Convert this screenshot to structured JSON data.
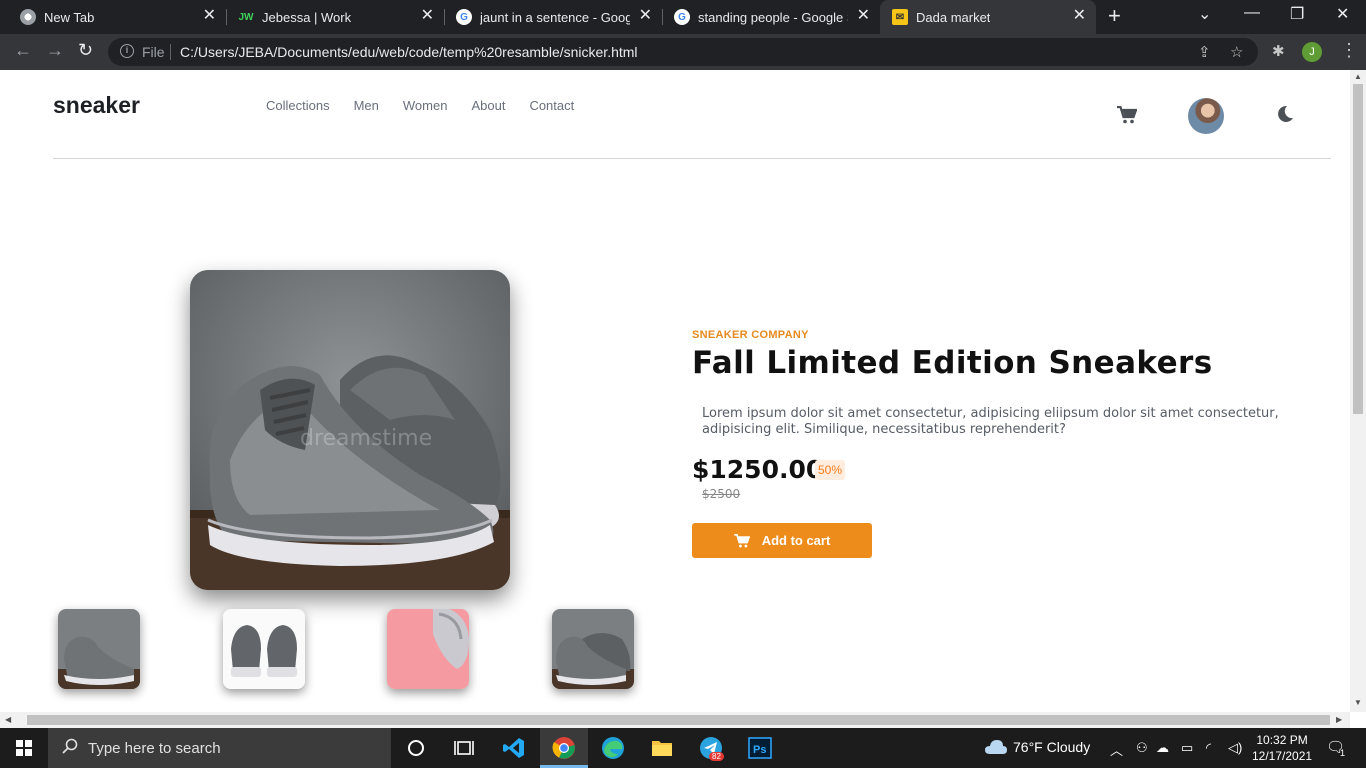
{
  "browser": {
    "tabs": [
      {
        "title": "New Tab",
        "icon": "chrome-icon"
      },
      {
        "title": "Jebessa | Work",
        "icon": "work-site-icon"
      },
      {
        "title": "jaunt in a sentence - Google",
        "icon": "google-icon"
      },
      {
        "title": "standing people - Google Se",
        "icon": "google-icon"
      },
      {
        "title": "Dada market",
        "icon": "envelope-icon"
      }
    ],
    "file_label": "File",
    "url": "C:/Users/JEBA/Documents/edu/web/code/temp%20resamble/snicker.html",
    "profile_initial": "J"
  },
  "site": {
    "logo": "sneaker",
    "nav": [
      "Collections",
      "Men",
      "Women",
      "About",
      "Contact"
    ]
  },
  "product": {
    "company": "SNEAKER COMPANY",
    "title": "Fall Limited Edition Sneakers",
    "description": "Lorem ipsum dolor sit amet consectetur, adipisicing eliipsum dolor sit amet consectetur, adipisicing elit. Similique, necessitatibus reprehenderit?",
    "price": "$1250.00",
    "discount": "50%",
    "old_price": "$2500",
    "add_to_cart": "Add to cart",
    "watermark": "dreamstime"
  },
  "colors": {
    "accent": "#ee8c1b",
    "accent_text": "#e58a1f",
    "discount_bg": "#ffede0"
  },
  "taskbar": {
    "search_placeholder": "Type here to search",
    "weather": "76°F  Cloudy",
    "time": "10:32 PM",
    "date": "12/17/2021",
    "telegram_badge": "82",
    "notification_count": "1"
  }
}
